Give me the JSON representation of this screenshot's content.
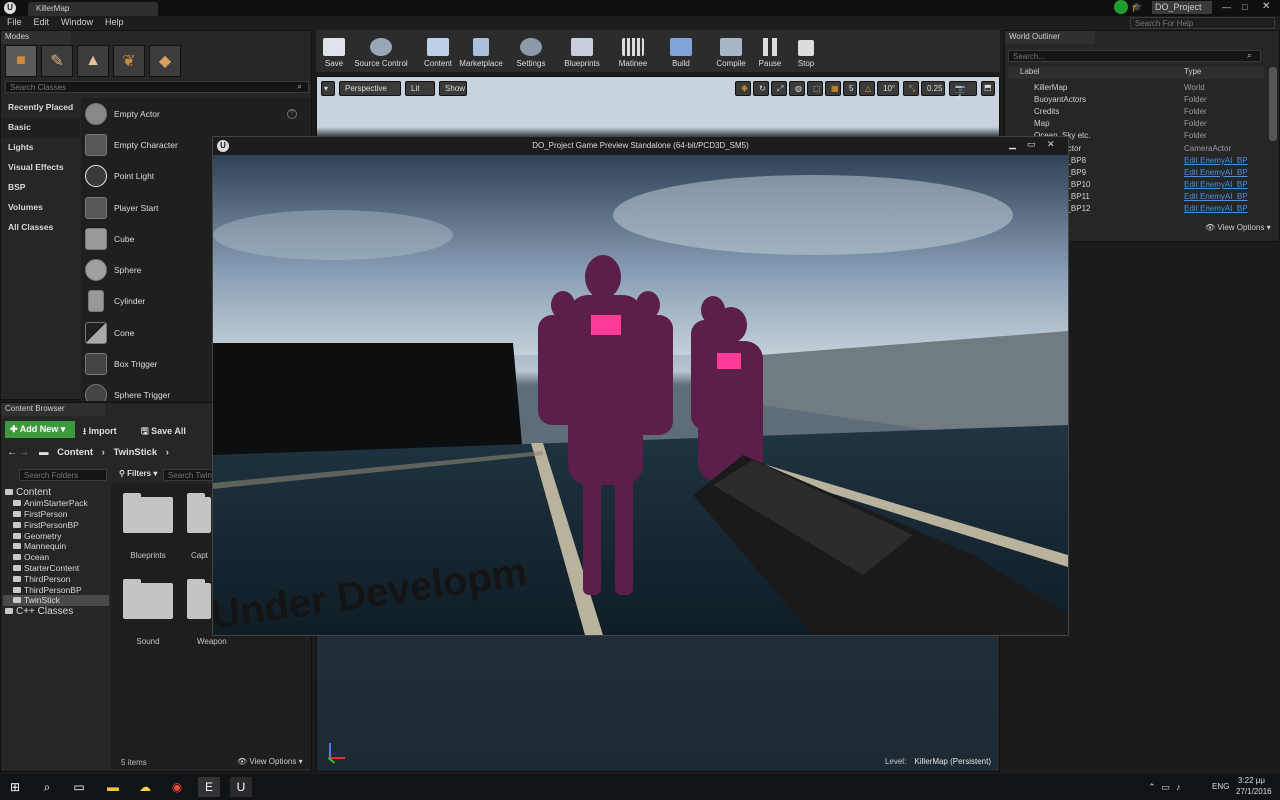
{
  "window": {
    "tab_title": "KillerMap",
    "project": "DO_Project",
    "help_search": "Search For Help"
  },
  "menu": [
    "File",
    "Edit",
    "Window",
    "Help"
  ],
  "modes": {
    "tab": "Modes",
    "search_placeholder": "Search Classes",
    "categories": [
      "Recently Placed",
      "Basic",
      "Lights",
      "Visual Effects",
      "BSP",
      "Volumes",
      "All Classes"
    ],
    "items": [
      "Empty Actor",
      "Empty Character",
      "Point Light",
      "Player Start",
      "Cube",
      "Sphere",
      "Cylinder",
      "Cone",
      "Box Trigger",
      "Sphere Trigger"
    ]
  },
  "toolbar": [
    {
      "label": "Save",
      "icon": "save-icon"
    },
    {
      "label": "Source Control",
      "icon": "source-control-icon"
    },
    {
      "label": "Content",
      "icon": "content-icon"
    },
    {
      "label": "Marketplace",
      "icon": "marketplace-icon"
    },
    {
      "label": "Settings",
      "icon": "settings-icon"
    },
    {
      "label": "Blueprints",
      "icon": "blueprints-icon"
    },
    {
      "label": "Matinee",
      "icon": "matinee-icon"
    },
    {
      "label": "Build",
      "icon": "build-icon"
    },
    {
      "label": "Compile",
      "icon": "compile-icon"
    },
    {
      "label": "Pause",
      "icon": "pause-icon"
    },
    {
      "label": "Stop",
      "icon": "stop-icon"
    }
  ],
  "viewport": {
    "perspective": "Perspective",
    "lit": "Lit",
    "show": "Show",
    "grid_snap": "5",
    "rot_snap": "10°",
    "scale_snap": "0.25",
    "cam_speed": "4",
    "level_label": "Level:",
    "level_name": "KillerMap (Persistent)"
  },
  "preview": {
    "title": "DO_Project Game Preview Standalone (64-bit/PCD3D_SM5)",
    "overlay_text": "Under Developm"
  },
  "outliner": {
    "tab": "World Outliner",
    "search_placeholder": "Search...",
    "col_label": "Label",
    "col_type": "Type",
    "view_options": "View Options",
    "rows": [
      {
        "label": "KillerMap",
        "type": "World",
        "link": false
      },
      {
        "label": "BuoyantActors",
        "type": "Folder",
        "link": false
      },
      {
        "label": "Credits",
        "type": "Folder",
        "link": false
      },
      {
        "label": "Map",
        "type": "Folder",
        "link": false
      },
      {
        "label": "Ocean, Sky etc.",
        "type": "Folder",
        "link": false
      },
      {
        "label": "CameraActor",
        "type": "CameraActor",
        "link": false
      },
      {
        "label": "EnemyAI_BP8",
        "type": "Edit EnemyAI_BP",
        "link": true
      },
      {
        "label": "EnemyAI_BP9",
        "type": "Edit EnemyAI_BP",
        "link": true
      },
      {
        "label": "EnemyAI_BP10",
        "type": "Edit EnemyAI_BP",
        "link": true
      },
      {
        "label": "EnemyAI_BP11",
        "type": "Edit EnemyAI_BP",
        "link": true
      },
      {
        "label": "EnemyAI_BP12",
        "type": "Edit EnemyAI_BP",
        "link": true
      }
    ]
  },
  "content_browser": {
    "tab": "Content Browser",
    "add_new": "Add New",
    "import": "Import",
    "save_all": "Save All",
    "path": [
      "Content",
      "TwinStick"
    ],
    "search_folders": "Search Folders",
    "filters": "Filters",
    "search_assets": "Search TwinStick",
    "root": "Content",
    "folders": [
      "AnimStarterPack",
      "FirstPerson",
      "FirstPersonBP",
      "Geometry",
      "Mannequin",
      "Ocean",
      "StarterContent",
      "ThirdPerson",
      "ThirdPersonBP",
      "TwinStick"
    ],
    "cpp": "C++ Classes",
    "assets": [
      "Blueprints",
      "Capt",
      "Sound",
      "Weapon"
    ],
    "count": "5 items",
    "view_options": "View Options"
  },
  "taskbar": {
    "lang": "ENG",
    "time": "3:22 μμ",
    "date": "27/1/2016"
  }
}
